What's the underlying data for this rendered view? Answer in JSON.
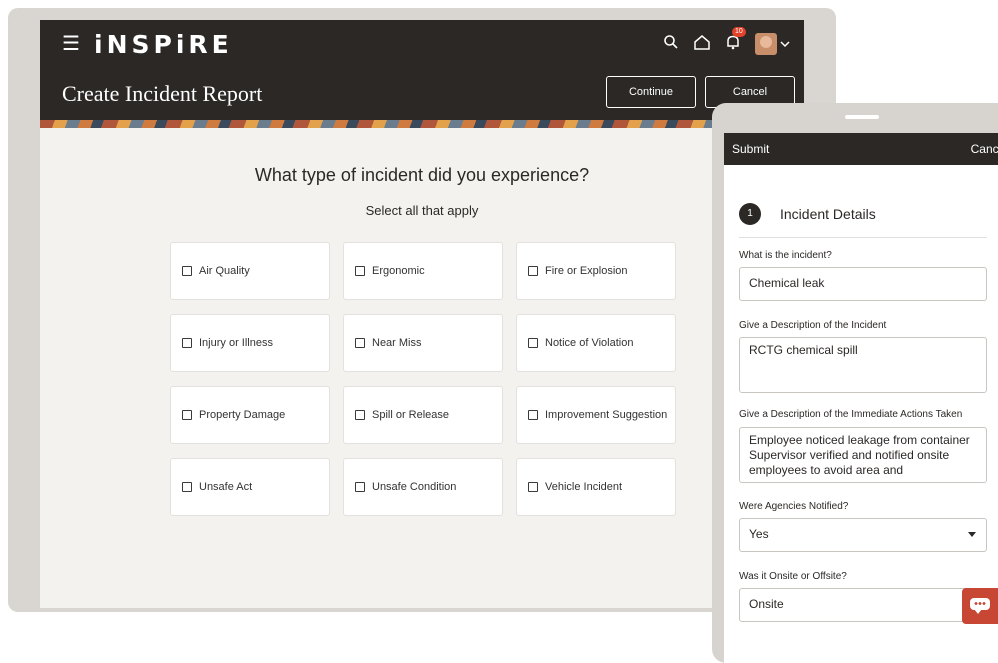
{
  "app": {
    "brand": "iNSPiRE",
    "notification_count": "10"
  },
  "header": {
    "title": "Create Incident Report",
    "continue_label": "Continue",
    "cancel_label": "Cancel"
  },
  "form": {
    "question": "What type of incident did you experience?",
    "instruction": "Select all that apply",
    "options": [
      "Air Quality",
      "Ergonomic",
      "Fire or Explosion",
      "Injury or Illness",
      "Near Miss",
      "Notice of Violation",
      "Property Damage",
      "Spill or Release",
      "Improvement Suggestion",
      "Unsafe Act",
      "Unsafe Condition",
      "Vehicle Incident"
    ]
  },
  "mobile": {
    "submit_label": "Submit",
    "cancel_label": "Cancel",
    "step_number": "1",
    "section_title": "Incident Details",
    "fields": {
      "incident_label": "What is the incident?",
      "incident_value": "Chemical leak",
      "description_label": "Give a Description of the Incident",
      "description_value": "RCTG chemical spill",
      "actions_label": "Give a Description of the Immediate Actions Taken",
      "actions_value": "Employee noticed leakage from container\nSupervisor verified and notified onsite employees to avoid area and",
      "agencies_label": "Were Agencies Notified?",
      "agencies_value": "Yes",
      "location_label": "Was it Onsite or Offsite?",
      "location_value": "Onsite"
    }
  },
  "colors": {
    "header_bg": "#2b2826",
    "accent_red": "#c74634",
    "page_bg": "#f3f2ef"
  },
  "icons": [
    "menu-icon",
    "search-icon",
    "home-icon",
    "notifications-icon",
    "chevron-down-icon",
    "chat-icon"
  ]
}
